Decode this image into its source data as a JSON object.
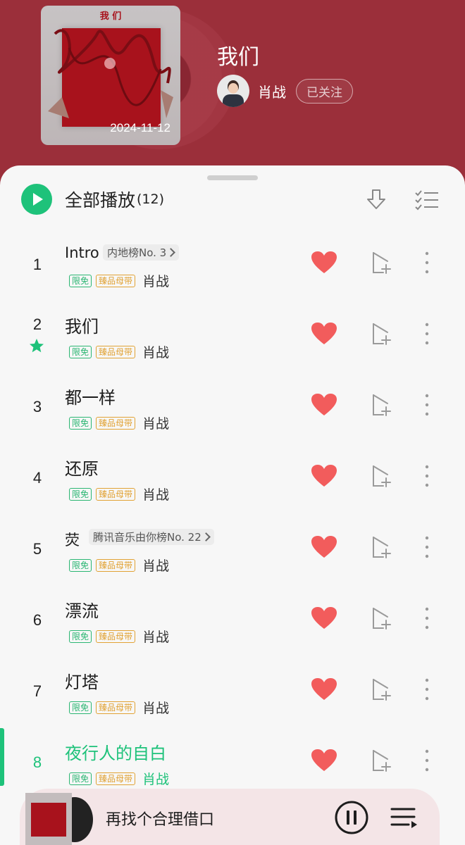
{
  "album": {
    "title": "我们",
    "cover_title": "我 们",
    "release_date": "2024-11-12",
    "artist": "肖战",
    "follow_label": "已关注"
  },
  "toolbar": {
    "play_all_label": "全部播放",
    "count_label": "(12)"
  },
  "badges": {
    "free": "限免",
    "master": "臻品母带"
  },
  "songs": [
    {
      "index": "1",
      "title": "Intro",
      "artist": "肖战",
      "rank": "内地榜No. 3"
    },
    {
      "index": "2",
      "title": "我们",
      "artist": "肖战",
      "starred": true
    },
    {
      "index": "3",
      "title": "都一样",
      "artist": "肖战"
    },
    {
      "index": "4",
      "title": "还原",
      "artist": "肖战"
    },
    {
      "index": "5",
      "title": "荧",
      "artist": "肖战",
      "rank": "腾讯音乐由你榜No. 22"
    },
    {
      "index": "6",
      "title": "漂流",
      "artist": "肖战"
    },
    {
      "index": "7",
      "title": "灯塔",
      "artist": "肖战"
    },
    {
      "index": "8",
      "title": "夜行人的自白",
      "artist": "肖战",
      "active": true
    }
  ],
  "now_playing": {
    "title": "再找个合理借口"
  },
  "colors": {
    "header_bg": "#9b2f3a",
    "accent_green": "#1ec27a",
    "heart_red": "#f25c5c",
    "master_gold": "#e1a234"
  },
  "icons": [
    "play-icon",
    "download-icon",
    "multiselect-icon",
    "heart-icon",
    "add-to-playlist-icon",
    "more-icon",
    "star-icon",
    "pause-icon",
    "playlist-icon"
  ]
}
